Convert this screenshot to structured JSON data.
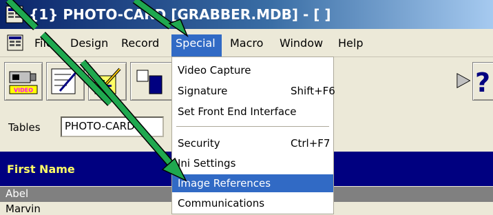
{
  "window": {
    "title": "{1} PHOTO-CARD [GRABBER.MDB] - [ ]"
  },
  "menubar": {
    "items": [
      "File",
      "Design",
      "Record",
      "Special",
      "Macro",
      "Window",
      "Help"
    ]
  },
  "toolbar": {
    "video_label": "VIDEO"
  },
  "tables": {
    "label": "Tables",
    "value": "PHOTO-CARD"
  },
  "grid": {
    "header": "First Name",
    "rows": [
      "Abel",
      "Marvin"
    ]
  },
  "special_menu": {
    "items": [
      {
        "label": "Video Capture",
        "shortcut": ""
      },
      {
        "label": "Signature",
        "shortcut": "Shift+F6"
      },
      {
        "label": "Set Front End Interface",
        "shortcut": ""
      },
      {
        "label": "Security",
        "shortcut": "Ctrl+F7"
      },
      {
        "label": "Ini Settings",
        "shortcut": ""
      },
      {
        "label": "Image References",
        "shortcut": ""
      },
      {
        "label": "Communications",
        "shortcut": ""
      }
    ],
    "highlighted_index": 5
  },
  "annotations": {
    "arrow_color": "#1fa84f"
  },
  "colors": {
    "menu_highlight": "#316ac5",
    "grid_header_bg": "#000080",
    "grid_header_text": "#ffff66"
  }
}
